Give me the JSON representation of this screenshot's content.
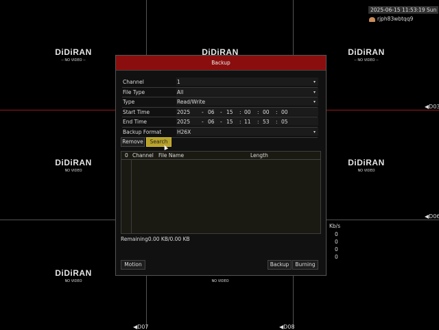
{
  "overlay": {
    "datetime": "2025-06-15 11:53:19 Sun",
    "username": "rjph83wbtqq9",
    "bitrate_unit": "Kb/s",
    "bitrate_values": [
      "0",
      "0",
      "0",
      "0"
    ]
  },
  "tiles": {
    "logo": "DiDiRAN",
    "no_video": "NO VIDEO",
    "no_video_dashed": "-- NO VIDEO --"
  },
  "channels": {
    "ch3": "◀D03",
    "ch6": "◀D06",
    "ch7": "◀D07",
    "ch8": "◀D08"
  },
  "dialog": {
    "title": "Backup",
    "fields": [
      {
        "label": "Channel",
        "value": "1"
      },
      {
        "label": "File Type",
        "value": "All"
      },
      {
        "label": "Type",
        "value": "Read/Write"
      },
      {
        "label": "Start Time"
      },
      {
        "label": "End Time"
      },
      {
        "label": "Backup Format",
        "value": "H26X"
      }
    ],
    "start_time": {
      "year": "2025",
      "month": "06",
      "day": "15",
      "hour": "00",
      "minute": "00",
      "second": "00"
    },
    "end_time": {
      "year": "2025",
      "month": "06",
      "day": "15",
      "hour": "11",
      "minute": "53",
      "second": "05"
    },
    "date_sep": "-",
    "time_sep": ":",
    "remove_label": "Remove",
    "search_label": "Search",
    "table_headers": {
      "index": "0",
      "channel": "Channel",
      "file_name": "File Name",
      "length": "Length"
    },
    "remaining": "Remaining0.00 KB/0.00 KB",
    "motion_label": "Motion",
    "backup_label": "Backup",
    "burning_label": "Burning"
  },
  "colors": {
    "titlebar": "#8a0e0e",
    "search_button": "#b7a22a"
  }
}
